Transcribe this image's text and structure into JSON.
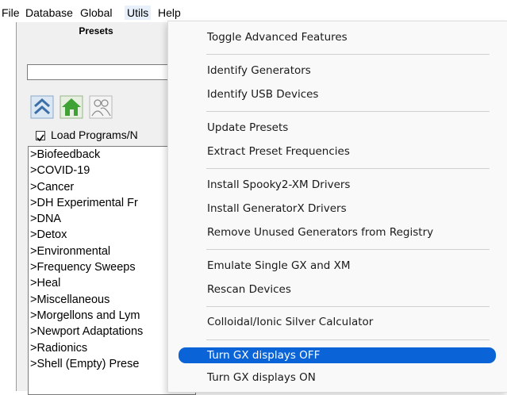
{
  "menubar": {
    "file": "File",
    "database": "Database",
    "global": "Global",
    "utils": "Utils",
    "help": "Help"
  },
  "presets_panel": {
    "title": "Presets",
    "search_value": "",
    "load_checkbox_label": "Load Programs/N",
    "load_checked": true,
    "tree_items": [
      ">Biofeedback",
      ">COVID-19",
      ">Cancer",
      ">DH Experimental Fr",
      ">DNA",
      ">Detox",
      ">Environmental",
      ">Frequency Sweeps",
      ">Heal",
      ">Miscellaneous",
      ">Morgellons and Lym",
      ">Newport Adaptations",
      ">Radionics",
      ">Shell (Empty) Prese"
    ]
  },
  "utils_menu": {
    "items": [
      "Toggle Advanced Features",
      "Identify Generators",
      "Identify USB Devices",
      "Update Presets",
      "Extract Preset Frequencies",
      "Install Spooky2-XM Drivers",
      "Install GeneratorX Drivers",
      "Remove Unused Generators from Registry",
      "Emulate Single GX and XM",
      "Rescan Devices",
      "Colloidal/Ionic Silver Calculator",
      "Turn GX displays OFF",
      "Turn GX displays ON"
    ],
    "highlighted_item": "Turn GX displays OFF",
    "highlight_color": "#0a64d8"
  },
  "icons": [
    "collapse-up-icon",
    "home-icon",
    "users-icon"
  ]
}
